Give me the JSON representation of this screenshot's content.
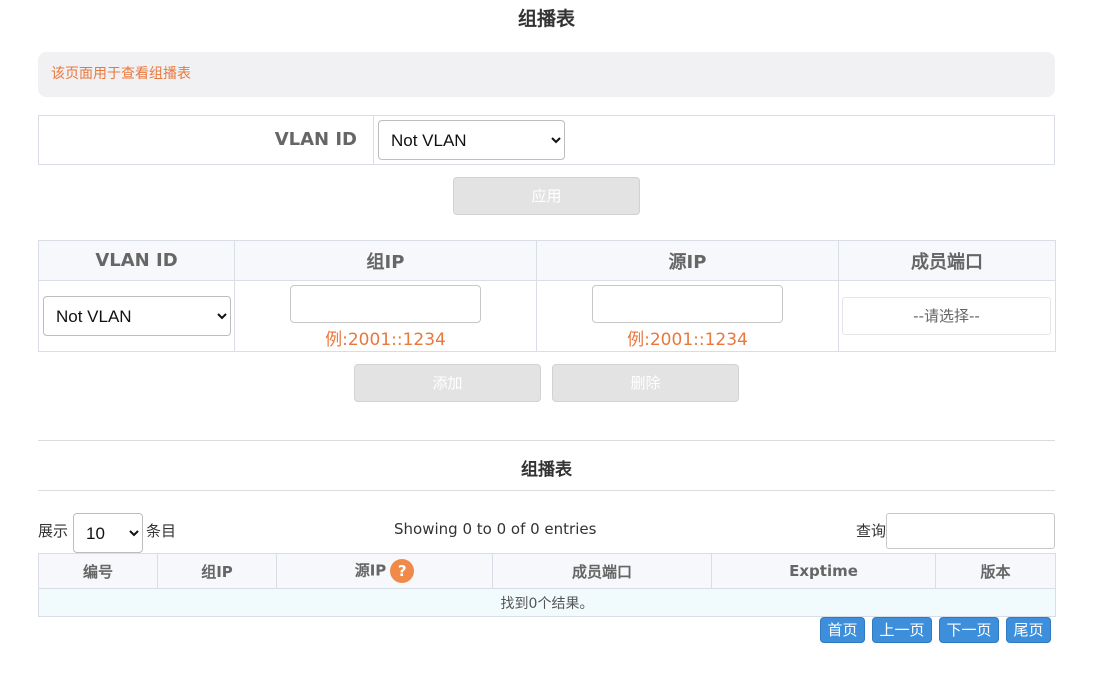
{
  "page": {
    "title": "组播表",
    "info": "该页面用于查看组播表"
  },
  "filter": {
    "label": "VLAN ID",
    "selected": "Not VLAN",
    "apply_label": "应用"
  },
  "add_form": {
    "headers": [
      "VLAN ID",
      "组IP",
      "源IP",
      "成员端口"
    ],
    "vlan_selected": "Not VLAN",
    "group_ip_example": "例:2001::1234",
    "source_ip_example": "例:2001::1234",
    "port_placeholder": "--请选择--",
    "add_label": "添加",
    "delete_label": "删除"
  },
  "table_section": {
    "title": "组播表",
    "length_prefix": "展示",
    "length_value": "10",
    "length_suffix": "条目",
    "info": "Showing 0 to 0 of 0 entries",
    "search_label": "查询",
    "columns": [
      "编号",
      "组IP",
      "源IP",
      "成员端口",
      "Exptime",
      "版本"
    ],
    "help_glyph": "?",
    "empty_text": "找到0个结果。",
    "pager": {
      "first": "首页",
      "prev": "上一页",
      "next": "下一页",
      "last": "尾页"
    }
  },
  "colors": {
    "accent": "#e8783e",
    "pager_blue": "#3d8fdb",
    "disabled_button": "#e3e3e3"
  }
}
